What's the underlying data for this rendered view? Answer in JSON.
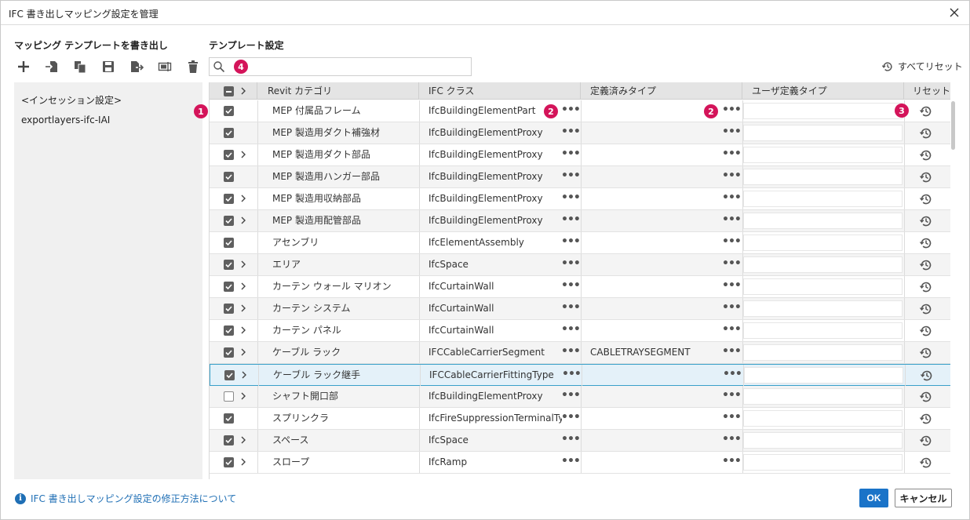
{
  "window": {
    "title": "IFC 書き出しマッピング設定を管理"
  },
  "left": {
    "section_title": "マッピング テンプレートを書き出し",
    "toolbar": [
      "new-icon",
      "import-icon",
      "duplicate-icon",
      "save-icon",
      "export-icon",
      "rename-icon",
      "delete-icon"
    ],
    "templates": [
      "<インセッション設定>",
      "exportlayers-ifc-IAI"
    ]
  },
  "right": {
    "section_title": "テンプレート設定",
    "search": {
      "value": "",
      "placeholder": ""
    },
    "reset_all_label": "すべてリセット"
  },
  "badges": {
    "b1": "1",
    "b2": "2",
    "b3": "3",
    "b4": "4"
  },
  "grid": {
    "headers": {
      "category": "Revit カテゴリ",
      "ifc_class": "IFC クラス",
      "predefined": "定義済みタイプ",
      "user_defined": "ユーザ定義タイプ",
      "reset": "リセット"
    },
    "rows": [
      {
        "checked": true,
        "expand": false,
        "category": "MEP 付属品フレーム",
        "ifc_class": "IfcBuildingElementPart",
        "predefined": ""
      },
      {
        "checked": true,
        "expand": false,
        "category": "MEP 製造用ダクト補強材",
        "ifc_class": "IfcBuildingElementProxy",
        "predefined": ""
      },
      {
        "checked": true,
        "expand": true,
        "category": "MEP 製造用ダクト部品",
        "ifc_class": "IfcBuildingElementProxy",
        "predefined": ""
      },
      {
        "checked": true,
        "expand": false,
        "category": "MEP 製造用ハンガー部品",
        "ifc_class": "IfcBuildingElementProxy",
        "predefined": ""
      },
      {
        "checked": true,
        "expand": true,
        "category": "MEP 製造用収納部品",
        "ifc_class": "IfcBuildingElementProxy",
        "predefined": ""
      },
      {
        "checked": true,
        "expand": true,
        "category": "MEP 製造用配管部品",
        "ifc_class": "IfcBuildingElementProxy",
        "predefined": ""
      },
      {
        "checked": true,
        "expand": false,
        "category": "アセンブリ",
        "ifc_class": "IfcElementAssembly",
        "predefined": ""
      },
      {
        "checked": true,
        "expand": true,
        "category": "エリア",
        "ifc_class": "IfcSpace",
        "predefined": ""
      },
      {
        "checked": true,
        "expand": true,
        "category": "カーテン ウォール マリオン",
        "ifc_class": "IfcCurtainWall",
        "predefined": ""
      },
      {
        "checked": true,
        "expand": true,
        "category": "カーテン システム",
        "ifc_class": "IfcCurtainWall",
        "predefined": ""
      },
      {
        "checked": true,
        "expand": true,
        "category": "カーテン パネル",
        "ifc_class": "IfcCurtainWall",
        "predefined": ""
      },
      {
        "checked": true,
        "expand": true,
        "category": "ケーブル ラック",
        "ifc_class": "IFCCableCarrierSegment",
        "predefined": "CABLETRAYSEGMENT"
      },
      {
        "checked": true,
        "expand": true,
        "category": "ケーブル ラック継手",
        "ifc_class": "IFCCableCarrierFittingType",
        "predefined": "",
        "selected": true
      },
      {
        "checked": false,
        "expand": true,
        "category": "シャフト開口部",
        "ifc_class": "IfcBuildingElementProxy",
        "predefined": ""
      },
      {
        "checked": true,
        "expand": false,
        "category": "スプリンクラ",
        "ifc_class": "IfcFireSuppressionTerminalTy",
        "predefined": ""
      },
      {
        "checked": true,
        "expand": true,
        "category": "スペース",
        "ifc_class": "IfcSpace",
        "predefined": ""
      },
      {
        "checked": true,
        "expand": true,
        "category": "スロープ",
        "ifc_class": "IfcRamp",
        "predefined": ""
      }
    ]
  },
  "footer": {
    "help_link": "IFC 書き出しマッピング設定の修正方法について",
    "ok_label": "OK",
    "cancel_label": "キャンセル"
  },
  "colors": {
    "accent": "#1a73c8",
    "badge": "#d4145a",
    "selection_border": "#39a0c9",
    "selection_fill": "#e4f1f9"
  }
}
